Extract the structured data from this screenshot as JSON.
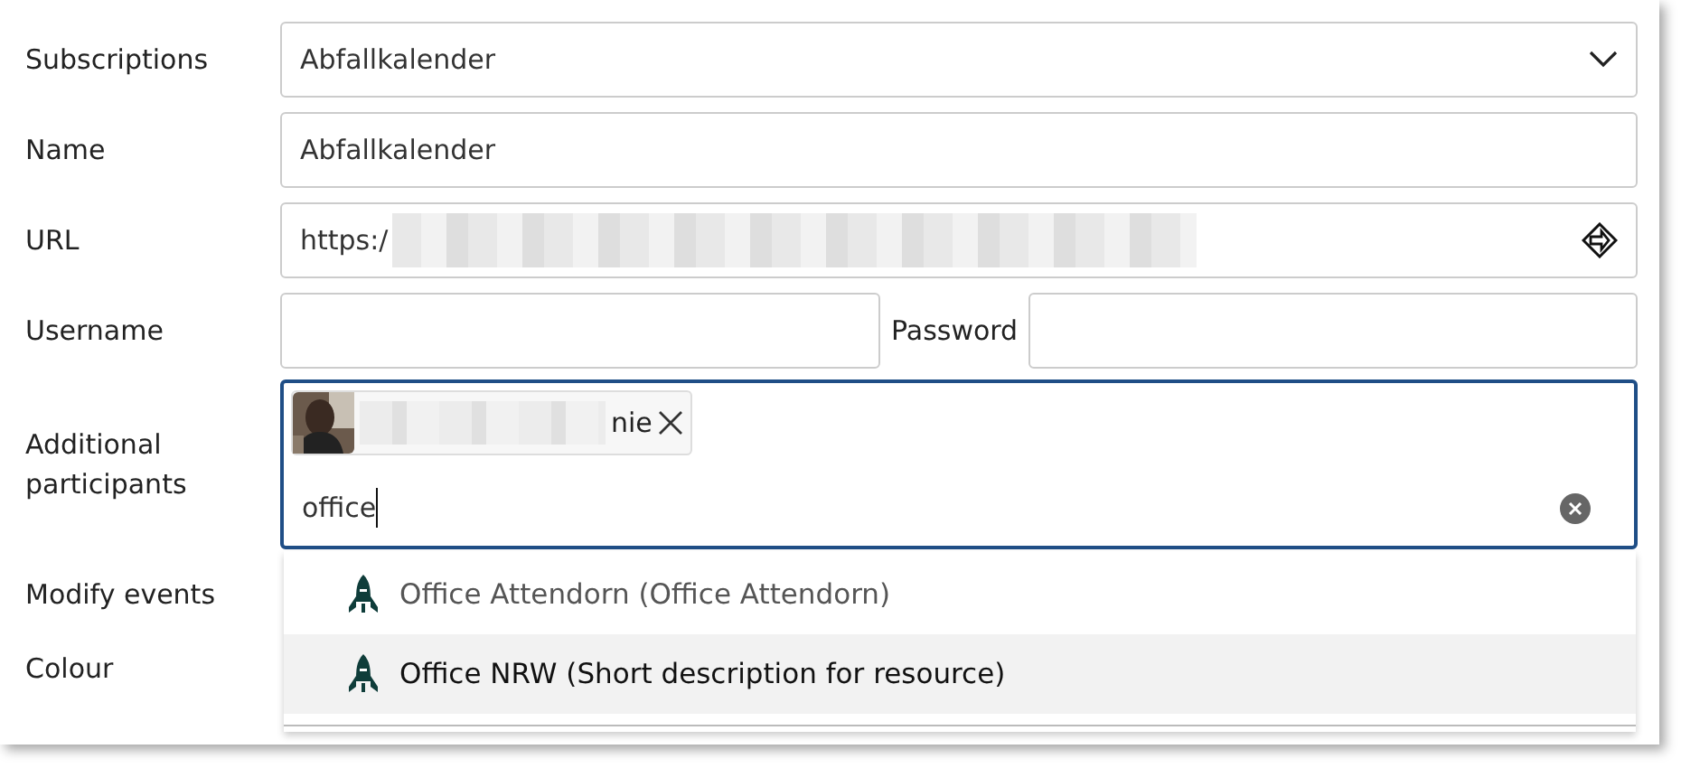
{
  "fields": [
    {
      "label": "Subscriptions",
      "kind": "select",
      "value": "Abfallkalender"
    },
    {
      "label": "Name",
      "kind": "text",
      "value": "Abfallkalender"
    },
    {
      "label": "URL",
      "kind": "url",
      "value": "https:/"
    }
  ],
  "credentials": {
    "username_label": "Username",
    "password_label": "Password"
  },
  "participants": {
    "label": "Additional participants",
    "chips": [
      {
        "name": "nie",
        "kind": "picture"
      }
    ],
    "query": "office"
  },
  "more_fields": [
    {
      "label": "Modify events"
    },
    {
      "label": "Colour"
    }
  ],
  "suggestions": [
    {
      "text": "Office Attendorn (Office Attendorn)",
      "selected": false
    },
    {
      "text": "Office NRW (Short description for resource)",
      "selected": true
    }
  ]
}
